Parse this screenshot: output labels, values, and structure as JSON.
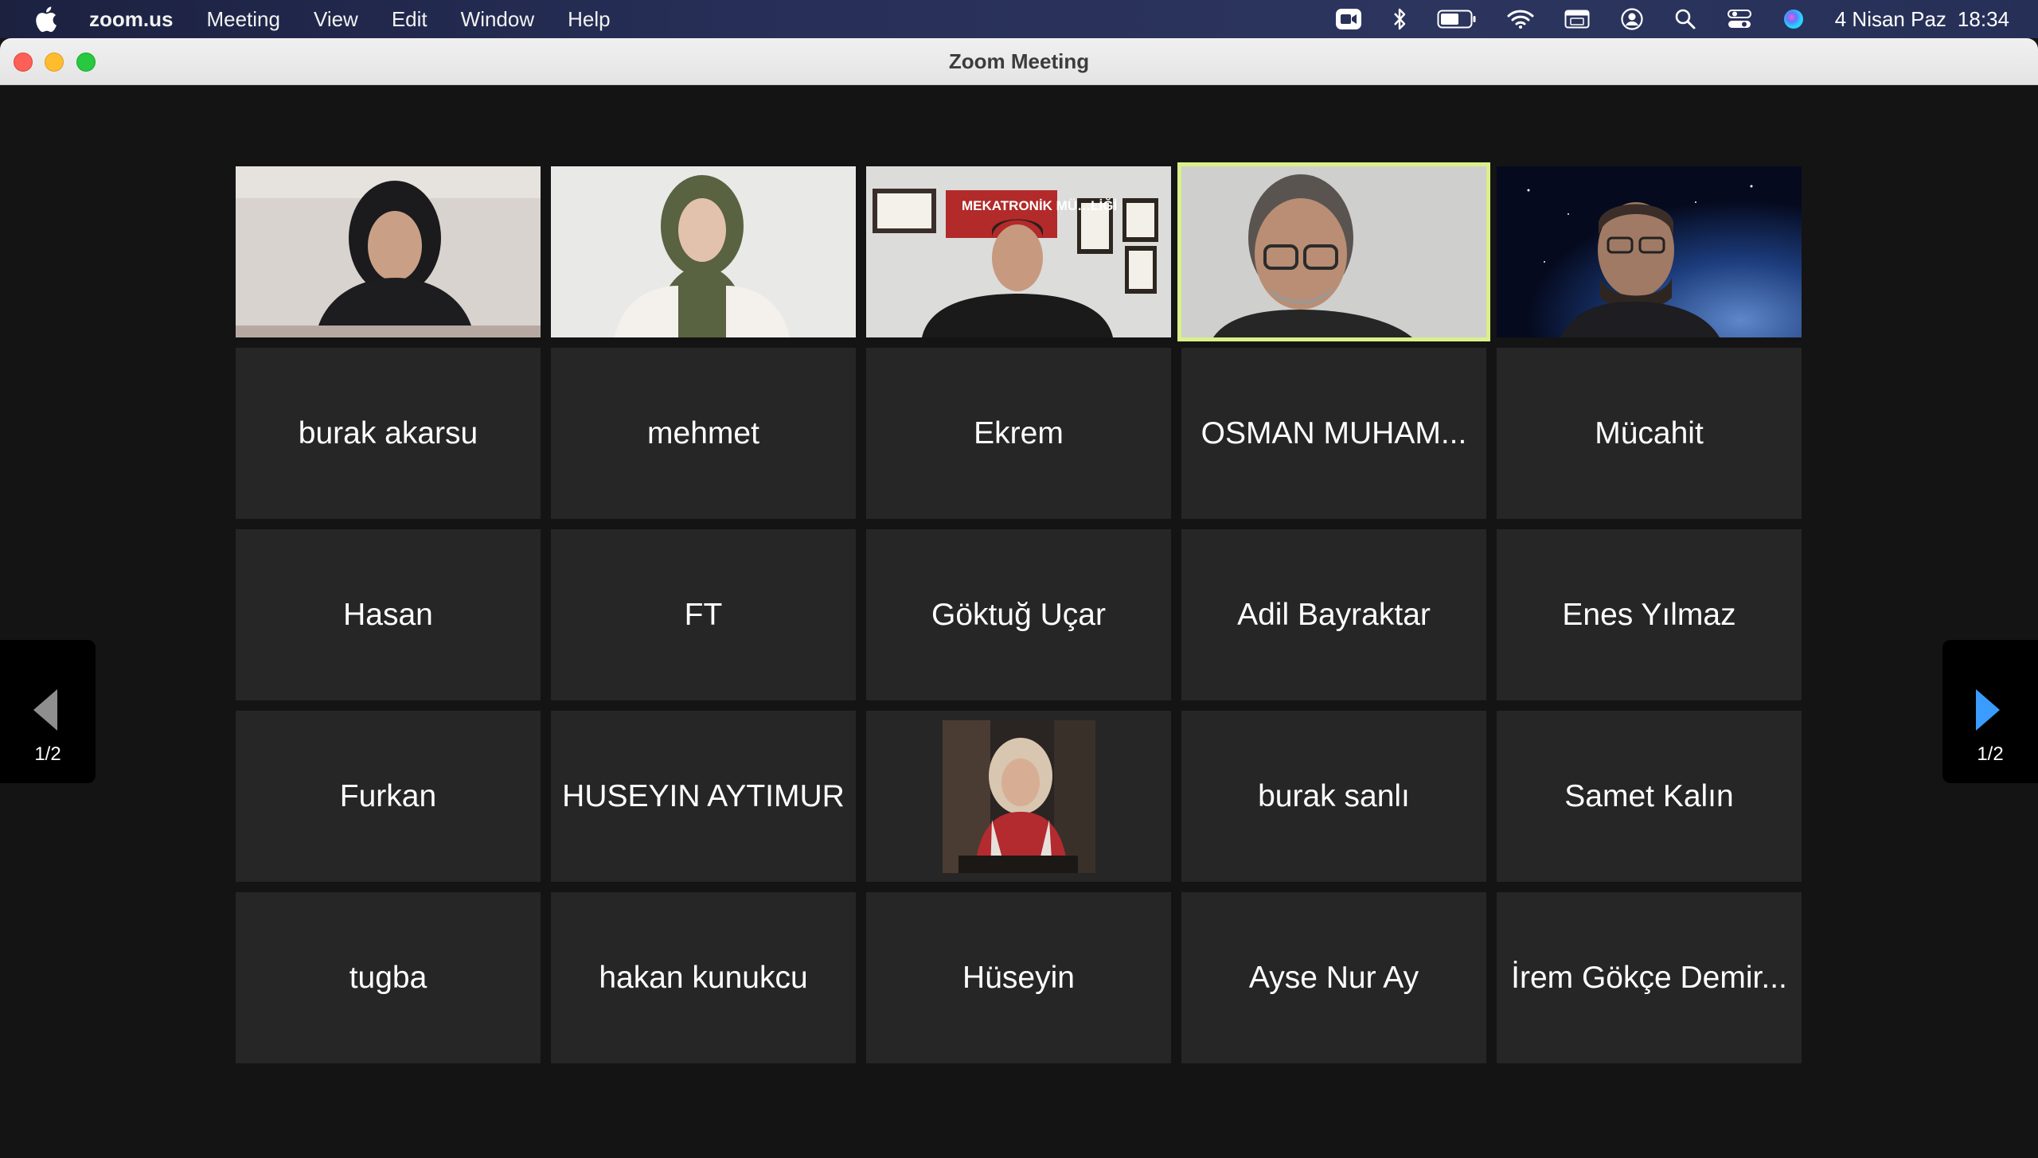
{
  "menubar": {
    "app": "zoom.us",
    "items": [
      "Meeting",
      "View",
      "Edit",
      "Window",
      "Help"
    ],
    "date": "4 Nisan Paz",
    "time": "18:34"
  },
  "window": {
    "title": "Zoom Meeting"
  },
  "video_tiles": [
    {
      "id": "v1",
      "speaking": false
    },
    {
      "id": "v2",
      "speaking": false
    },
    {
      "id": "v3",
      "speaking": false,
      "sign_text": "MEKATRONİK MÜ…LİĞİ"
    },
    {
      "id": "v4",
      "speaking": true
    },
    {
      "id": "v5",
      "speaking": false
    }
  ],
  "name_tiles": [
    "burak akarsu",
    "mehmet",
    "Ekrem",
    "OSMAN MUHAM...",
    "Mücahit",
    "Hasan",
    "FT",
    "Göktuğ Uçar",
    "Adil Bayraktar",
    "Enes Yılmaz",
    "Furkan",
    "HUSEYIN AYTIMUR",
    "",
    "burak sanlı",
    "Samet Kalın",
    "tugba",
    "hakan kunukcu",
    "Hüseyin",
    "Ayse Nur Ay",
    "İrem Gökçe Demir..."
  ],
  "pagination": {
    "left": "1/2",
    "right": "1/2"
  },
  "colors": {
    "active_border": "#d9f08a",
    "tile_bg": "#262626",
    "nav_arrow_right": "#3a9cff",
    "nav_arrow_left": "#8e8e8e"
  },
  "icons": [
    "apple-icon",
    "zoom-video-icon",
    "bluetooth-icon",
    "battery-icon",
    "wifi-icon",
    "keyboard-icon",
    "user-icon",
    "search-icon",
    "control-center-icon",
    "siri-icon",
    "arrow-left-icon",
    "arrow-right-icon"
  ]
}
